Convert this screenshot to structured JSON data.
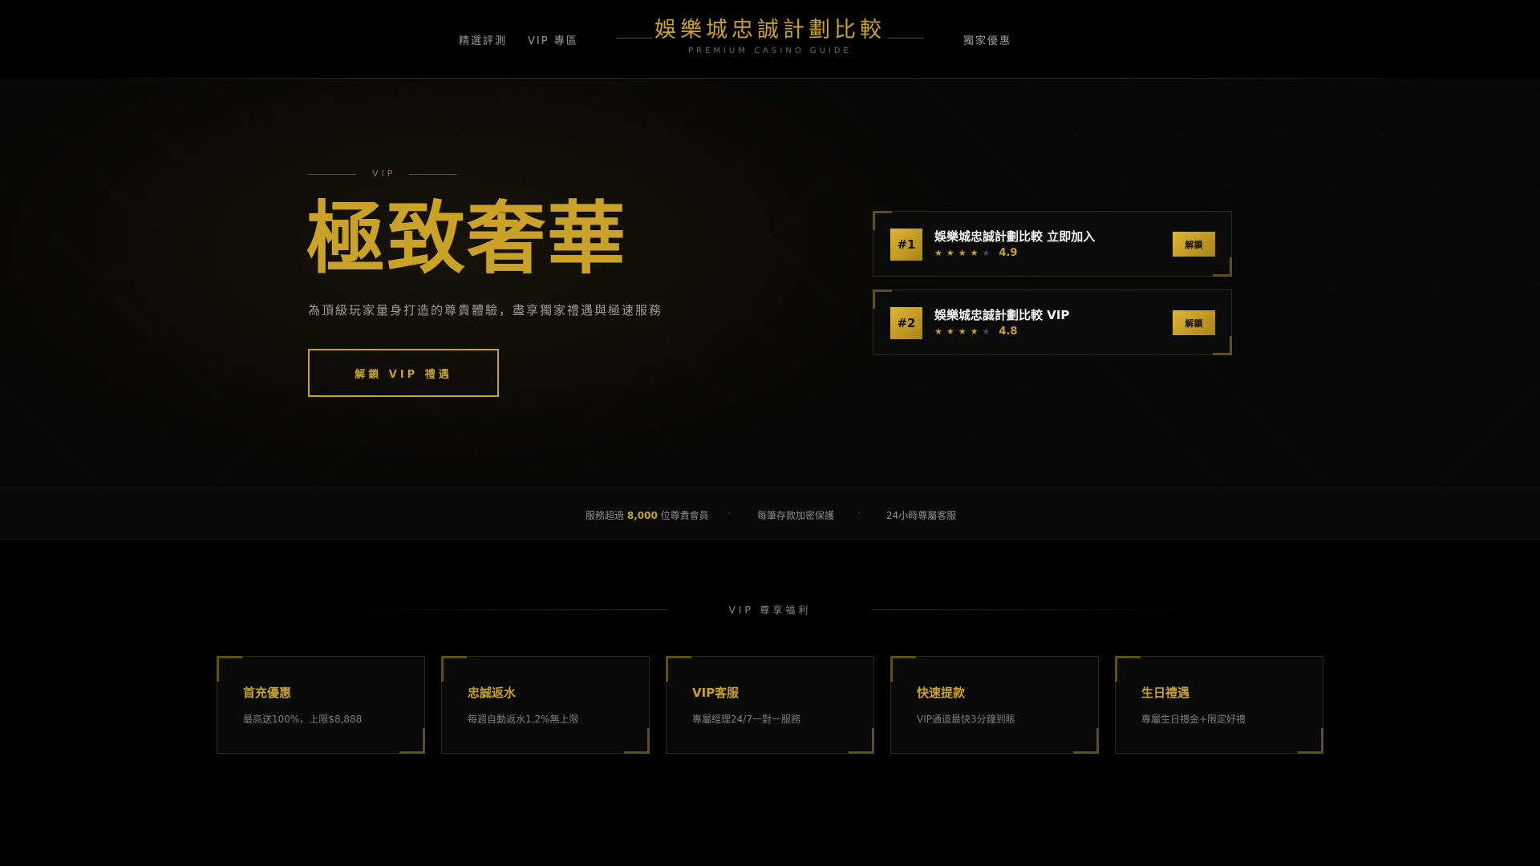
{
  "nav": {
    "links_left": [
      "精選評測",
      "VIP 專區"
    ],
    "links_right": [
      "獨家優惠"
    ]
  },
  "brand": {
    "title": "娛樂城忠誠計劃比較",
    "subtitle": "PREMIUM CASINO GUIDE"
  },
  "hero": {
    "eyebrow": "VIP",
    "title": "極致奢華",
    "subtitle": "為頂級玩家量身打造的尊貴體驗，盡享獨家禮遇與極速服務",
    "cta_label": "解鎖 VIP 禮遇"
  },
  "rankings": [
    {
      "rank": "#1",
      "name": "娛樂城忠誠計劃比較 立即加入",
      "stars": 4,
      "max_stars": 5,
      "score": "4.9",
      "button": "解鎖"
    },
    {
      "rank": "#2",
      "name": "娛樂城忠誠計劃比較 VIP",
      "stars": 4,
      "max_stars": 5,
      "score": "4.8",
      "button": "解鎖"
    }
  ],
  "stats": {
    "members_prefix": "服務超過",
    "members_count": "8,000",
    "members_suffix": "位尊貴會員",
    "separator": "·",
    "security": "每筆存款加密保護",
    "support": "24小時尊屬客服"
  },
  "benefits": {
    "section_title": "VIP 尊享福利",
    "items": [
      {
        "title": "首充優惠",
        "desc": "最高送100%，上限$8,888"
      },
      {
        "title": "忠誠返水",
        "desc": "每週自動返水1.2%無上限"
      },
      {
        "title": "VIP客服",
        "desc": "專屬經理24/7一對一服務"
      },
      {
        "title": "快速提款",
        "desc": "VIP通道最快3分鐘到賬"
      },
      {
        "title": "生日禮遇",
        "desc": "專屬生日禮金+限定好禮"
      }
    ]
  },
  "colors": {
    "gold": "#c9a227",
    "background": "#000000",
    "card": "#0b0b0c",
    "muted_text": "#9a9a9a"
  }
}
